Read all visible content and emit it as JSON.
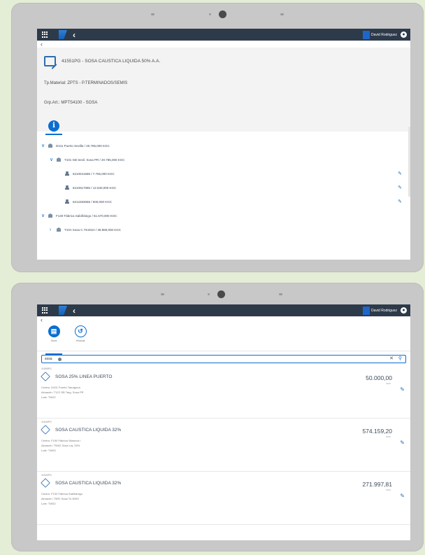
{
  "shell": {
    "user_name": "David Rodriguez"
  },
  "top_screen": {
    "object_title": "41551PG - SOSA CAUSTICA LIQUIDA 50% A.A.",
    "tp_material": "Tp.Material: ZPTS - P.TERMINADOS/SEMIS",
    "grp_art": "Grp.Art.: MPTS4100 - SOSA",
    "info_tab": "i",
    "tree": [
      {
        "text": "D411 Puerto Sevilla / 20.785,000 KGC",
        "expander": "∨",
        "icon": "plant-icon",
        "level": 0,
        "editable": false
      },
      {
        "text": "T101 GB Sevil. Sosa PR / 20.785,000 KGC",
        "expander": "∨",
        "icon": "storage-icon",
        "level": 1,
        "editable": false
      },
      {
        "text": "6210041585 / 7.755,000 KGC",
        "expander": "",
        "icon": "lot-icon",
        "level": 2,
        "editable": true
      },
      {
        "text": "6210017085 / 12.530,000 KGC",
        "expander": "",
        "icon": "lot-icon",
        "level": 2,
        "editable": true
      },
      {
        "text": "6212283065 / 500,000 KGC",
        "expander": "",
        "icon": "lot-icon",
        "level": 2,
        "editable": true
      },
      {
        "text": "F130 Fábrica Sabiñánigo / 51.670,000 KGC",
        "expander": "∨",
        "icon": "plant-icon",
        "level": 0,
        "editable": false
      },
      {
        "text": "T10A Sosa C.TK202A / 38.880,000 KGC",
        "expander": "›",
        "icon": "storage-icon",
        "level": 1,
        "editable": false
      }
    ]
  },
  "bottom_screen": {
    "tabs": [
      {
        "label": "Stock",
        "icon": "▤",
        "active": true
      },
      {
        "label": "Historial",
        "icon": "↺",
        "active": false
      }
    ],
    "search": {
      "value": "sosa",
      "clear": "✕",
      "search_icon": "⚲"
    },
    "items": [
      {
        "code": "41559PG",
        "name": "SOSA 25% LINEA PUERTO",
        "qty": "50.000,00",
        "unit": "KGC",
        "centro": "Centro: D431 Puerto Tarragona",
        "almacen": "Almacén: T122 GB Targ. Sosa PR",
        "lote": "Lote: TW22"
      },
      {
        "code": "41549PG",
        "name": "SOSA CAUSTICA LIQUIDA 32%",
        "qty": "574.159,20",
        "unit": "KGC",
        "centro": "Centro: F190 Fábrica Vilaseca I",
        "almacen": "Almacén: TW02 Sosa Liq. 33%",
        "lote": "Lote: TW03"
      },
      {
        "code": "41549PG",
        "name": "SOSA CAUSTICA LIQUIDA 32%",
        "qty": "271.997,81",
        "unit": "KGC",
        "centro": "Centro: F130 Fábrica Sabiñánigo",
        "almacen": "Almacén: T5R2 Sosa Tk 50R2",
        "lote": "Lote: TW02"
      }
    ]
  }
}
